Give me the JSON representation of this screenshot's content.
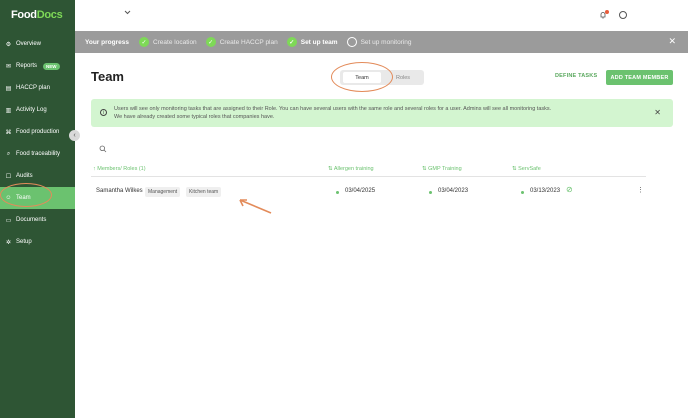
{
  "app": {
    "logo_part1": "Food",
    "logo_part2": "Docs"
  },
  "sidebar": {
    "items": [
      {
        "label": "Overview",
        "icon": "overview-icon"
      },
      {
        "label": "Reports",
        "icon": "reports-icon",
        "badge": "NEW"
      },
      {
        "label": "HACCP plan",
        "icon": "haccp-icon"
      },
      {
        "label": "Activity Log",
        "icon": "activity-icon"
      },
      {
        "label": "Food production",
        "icon": "food-production-icon"
      },
      {
        "label": "Food traceability",
        "icon": "traceability-icon"
      },
      {
        "label": "Audits",
        "icon": "audits-icon"
      },
      {
        "label": "Team",
        "icon": "team-icon",
        "active": true
      },
      {
        "label": "Documents",
        "icon": "documents-icon"
      },
      {
        "label": "Setup",
        "icon": "gear-icon"
      }
    ],
    "collapse": "‹"
  },
  "progress": {
    "label": "Your progress",
    "steps": [
      {
        "label": "Create location",
        "done": true
      },
      {
        "label": "Create HACCP plan",
        "done": true
      },
      {
        "label": "Set up team",
        "done": true,
        "current": true
      },
      {
        "label": "Set up monitoring",
        "done": false
      }
    ],
    "close": "✕"
  },
  "main": {
    "title": "Team",
    "toggle": {
      "team": "Team",
      "roles": "Roles"
    },
    "define_tasks": "DEFINE TASKS",
    "add_member": "ADD TEAM MEMBER",
    "info_line1": "Users will see only monitoring tasks that are assigned to their Role. You can have several users with the same role and several roles for a user. Admins will see all monitoring tasks.",
    "info_line2": "We have already created some typical roles that companies have.",
    "info_close": "✕"
  },
  "table": {
    "columns": [
      "Members/ Roles (1)",
      "Allergen training",
      "GMP Training",
      "ServSafe"
    ],
    "rows": [
      {
        "name": "Samantha Wilkes",
        "roles": [
          "Management",
          "Kitchen team"
        ],
        "allergen": "03/04/2025",
        "gmp": "03/04/2023",
        "servsafe": "03/13/2023"
      }
    ]
  },
  "colors": {
    "sidebar": "#2e5534",
    "accent": "#6bc26f",
    "annotation": "#e38b5a"
  }
}
